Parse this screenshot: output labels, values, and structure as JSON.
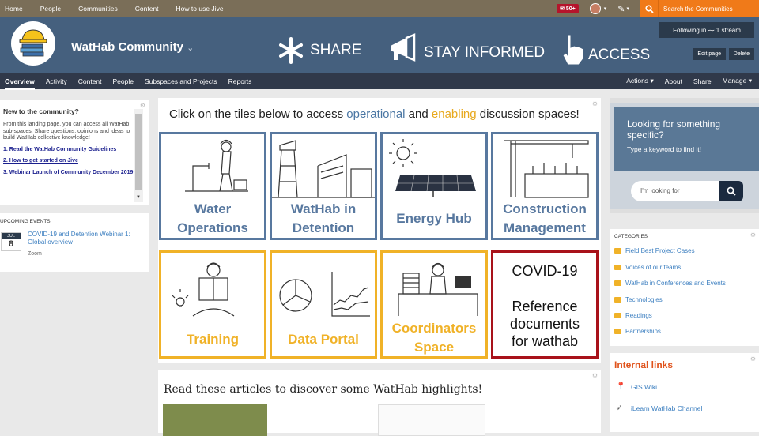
{
  "topnav": {
    "items": [
      "Home",
      "People",
      "Communities",
      "Content",
      "How to use Jive"
    ],
    "notifications": "50+",
    "search_label": "Search the Communities"
  },
  "header": {
    "community_title": "WatHab Community",
    "share": "SHARE",
    "stay_informed": "STAY INFORMED",
    "access": "ACCESS",
    "following": "Following in",
    "stream": "1 stream",
    "edit_page": "Edit page",
    "delete": "Delete"
  },
  "subnav": {
    "left": [
      "Overview",
      "Activity",
      "Content",
      "People",
      "Subspaces and Projects",
      "Reports"
    ],
    "right": [
      "Actions",
      "About",
      "Share",
      "Manage"
    ]
  },
  "welcome": {
    "title": "New to the community?",
    "body": "From this landing page, you can access all WatHab sub-spaces. Share questions, opinions and ideas to build WatHab collective knowledge!",
    "links": [
      "1. Read the WatHab Community Guidelines",
      "2. How to get started on Jive",
      "3. Webinar Launch of Community December 2019"
    ]
  },
  "events": {
    "title": "UPCOMING EVENTS",
    "month": "JUL",
    "day": "8",
    "name": "COVID-19 and Detention Webinar 1: Global overview",
    "location": "Zoom"
  },
  "center": {
    "headline_pre": "Click on the tiles below to access ",
    "headline_op": "operational",
    "headline_and": " and ",
    "headline_en": "enabling",
    "headline_post": " discussion spaces!",
    "tiles": [
      {
        "l1": "Water",
        "l2": "Operations"
      },
      {
        "l1": "WatHab in",
        "l2": "Detention"
      },
      {
        "l1": "Energy Hub",
        "l2": ""
      },
      {
        "l1": "Construction",
        "l2": "Management"
      },
      {
        "l1": "Training",
        "l2": ""
      },
      {
        "l1": "Data Portal",
        "l2": ""
      },
      {
        "l1": "Coordinators",
        "l2": "Space"
      },
      {
        "l1": "COVID-19",
        "l2": "Reference documents for wathab"
      }
    ],
    "articles_heading": "Read these articles to discover some WatHab highlights!"
  },
  "right": {
    "search_title": "Looking for something specific?",
    "search_sub": "Type a keyword to find it!",
    "search_placeholder": "I'm looking for",
    "categories_title": "CATEGORIES",
    "categories": [
      "Field Best Project Cases",
      "Voices of our teams",
      "WatHab in Conferences and Events",
      "Technologies",
      "Readings",
      "Partnerships"
    ],
    "links_title": "Internal links",
    "links": [
      "GIS Wiki",
      "iLearn WatHab Channel"
    ]
  },
  "colors": {
    "operational": "#58789f",
    "enabling": "#f0b228",
    "covid": "#a8121a",
    "search_accent": "#f07a19"
  }
}
